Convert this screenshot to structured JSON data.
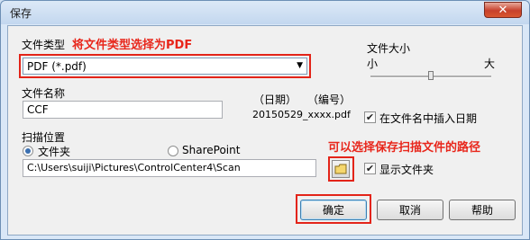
{
  "window": {
    "title": "保存",
    "close": "✕"
  },
  "file_type": {
    "label": "文件类型",
    "annotation": "将文件类型选择为PDF",
    "selected": "PDF (*.pdf)"
  },
  "file_size": {
    "label": "文件大小",
    "min_label": "小",
    "max_label": "大",
    "level": 0.5
  },
  "file_name": {
    "label": "文件名称",
    "value": "CCF"
  },
  "preview": {
    "date_label": "（日期）",
    "number_label": "（编号）",
    "filename": "20150529_xxxx.pdf"
  },
  "insert_date": {
    "label": "在文件名中插入日期",
    "checked": true
  },
  "scan_location": {
    "label": "扫描位置",
    "option_folder": "文件夹",
    "option_sharepoint": "SharePoint",
    "path": "C:\\Users\\suiji\\Pictures\\ControlCenter4\\Scan",
    "annotation": "可以选择保存扫描文件的路径"
  },
  "show_folder": {
    "label": "显示文件夹",
    "checked": true
  },
  "buttons": {
    "ok": "确定",
    "cancel": "取消",
    "help": "帮助"
  },
  "colors": {
    "annotation": "#e8261b",
    "frame": "#d9e7f7"
  }
}
